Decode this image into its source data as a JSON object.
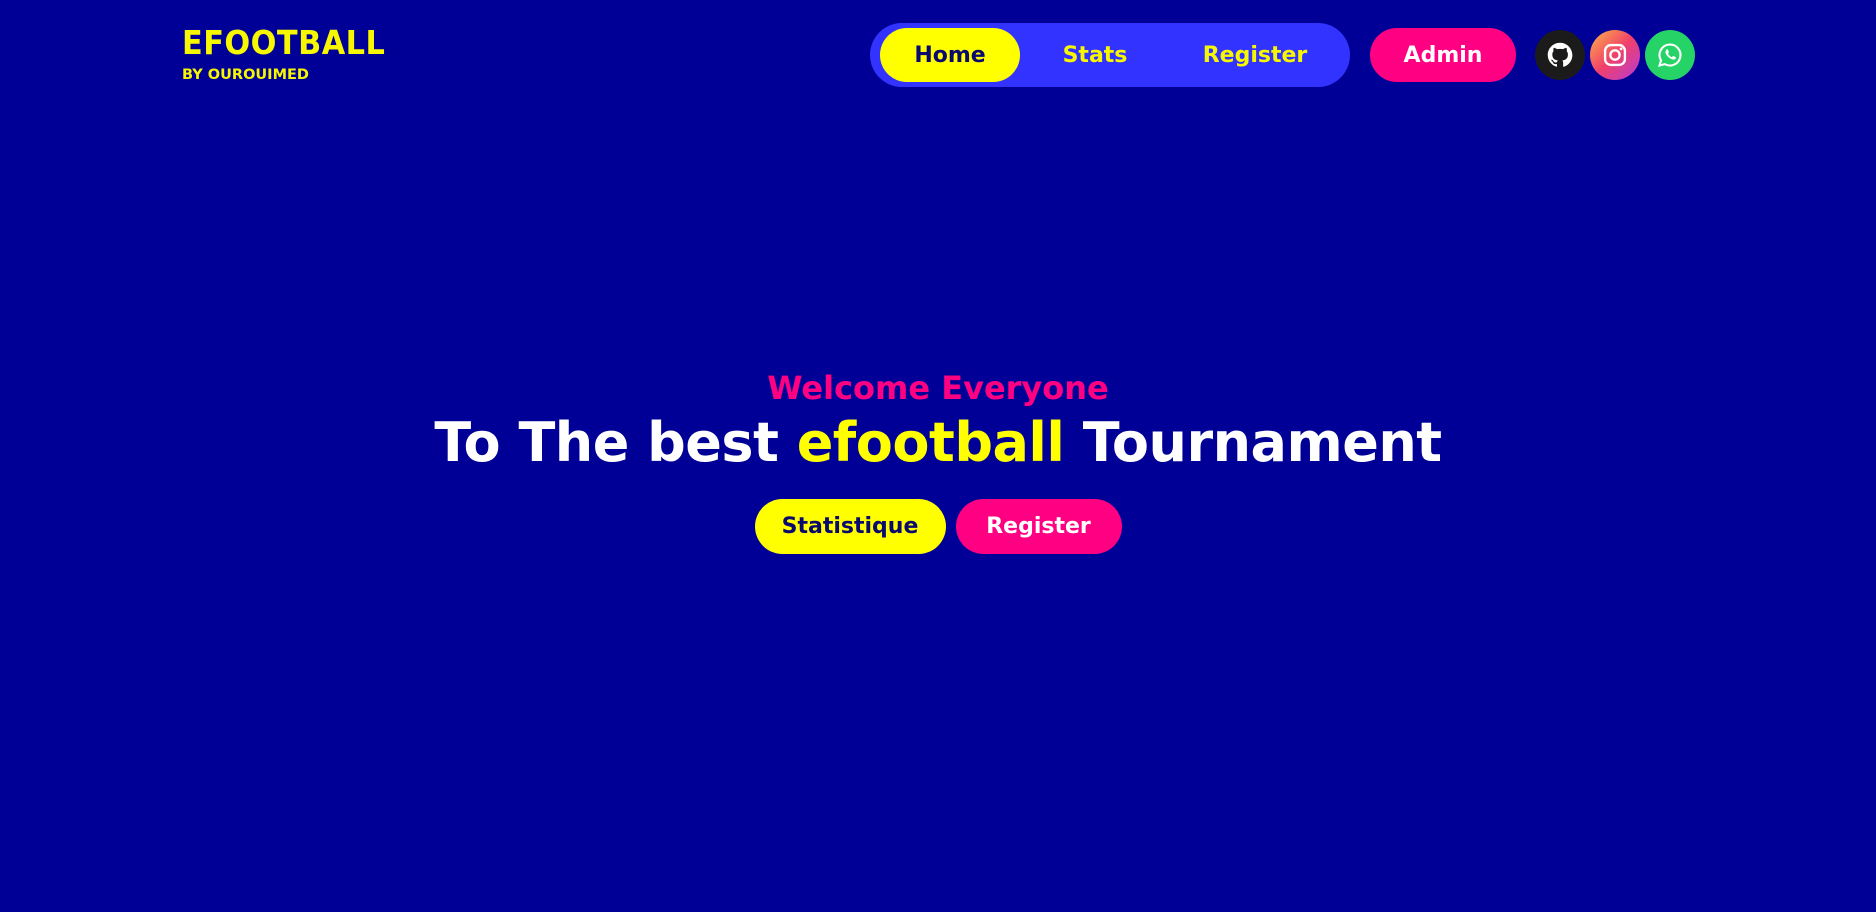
{
  "logo": {
    "title": "EFOOTBALL",
    "subtitle": "BY OUROUIMED"
  },
  "nav": {
    "items": [
      {
        "label": "Home",
        "active": true
      },
      {
        "label": "Stats",
        "active": false
      },
      {
        "label": "Register",
        "active": false
      }
    ],
    "admin_label": "Admin"
  },
  "social": {
    "github_icon": "github-icon",
    "instagram_icon": "instagram-icon",
    "whatsapp_icon": "whatsapp-icon"
  },
  "hero": {
    "welcome": "Welcome Everyone",
    "title_before": "To The best ",
    "title_accent": "efootball",
    "title_after": " Tournament",
    "primary_button": "Statistique",
    "secondary_button": "Register"
  },
  "colors": {
    "background": "#000096",
    "nav_pill": "#3333ff",
    "yellow": "#ffff00",
    "pink": "#ff0083",
    "white": "#ffffff"
  }
}
